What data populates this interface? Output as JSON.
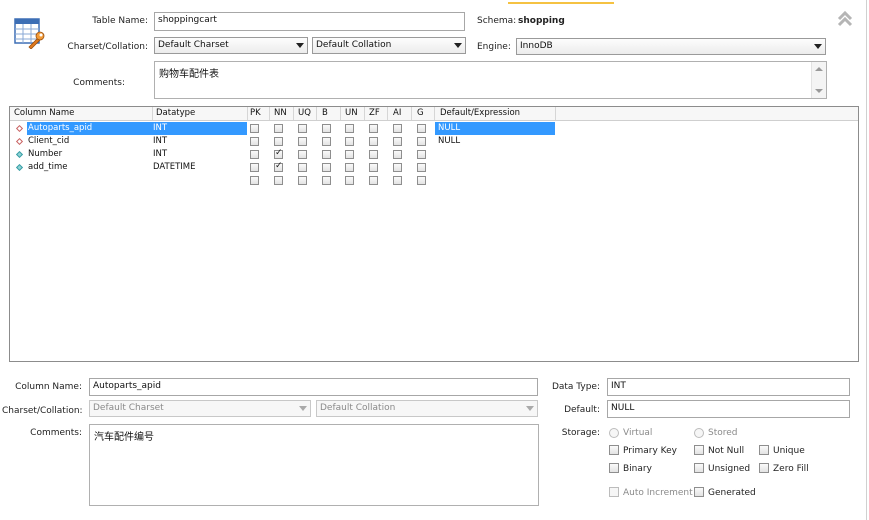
{
  "table": {
    "name_label": "Table Name:",
    "name_value": "shoppingcart",
    "schema_label": "Schema:",
    "schema_value": "shopping",
    "charset_label": "Charset/Collation:",
    "charset_value": "Default Charset",
    "collation_value": "Default Collation",
    "engine_label": "Engine:",
    "engine_value": "InnoDB",
    "comments_label": "Comments:",
    "comments_value": "购物车配件表"
  },
  "grid": {
    "headers": [
      "Column Name",
      "Datatype",
      "PK",
      "NN",
      "UQ",
      "B",
      "UN",
      "ZF",
      "AI",
      "G",
      "Default/Expression"
    ],
    "rows": [
      {
        "name": "Autoparts_apid",
        "type": "INT",
        "flags": [
          false,
          false,
          false,
          false,
          false,
          false,
          false,
          false
        ],
        "default": "NULL",
        "selected": true,
        "icon": "red"
      },
      {
        "name": "Client_cid",
        "type": "INT",
        "flags": [
          false,
          false,
          false,
          false,
          false,
          false,
          false,
          false
        ],
        "default": "NULL",
        "selected": false,
        "icon": "red"
      },
      {
        "name": "Number",
        "type": "INT",
        "flags": [
          false,
          true,
          false,
          false,
          false,
          false,
          false,
          false
        ],
        "default": "",
        "selected": false,
        "icon": "teal"
      },
      {
        "name": "add_time",
        "type": "DATETIME",
        "flags": [
          false,
          true,
          false,
          false,
          false,
          false,
          false,
          false
        ],
        "default": "",
        "selected": false,
        "icon": "teal"
      }
    ]
  },
  "column": {
    "name_label": "Column Name:",
    "name_value": "Autoparts_apid",
    "charset_label": "Charset/Collation:",
    "charset_value": "Default Charset",
    "collation_value": "Default Collation",
    "comments_label": "Comments:",
    "comments_value": "汽车配件编号",
    "datatype_label": "Data Type:",
    "datatype_value": "INT",
    "default_label": "Default:",
    "default_value": "NULL",
    "storage_label": "Storage:",
    "virtual_label": "Virtual",
    "stored_label": "Stored",
    "primary_key_label": "Primary Key",
    "not_null_label": "Not Null",
    "unique_label": "Unique",
    "binary_label": "Binary",
    "unsigned_label": "Unsigned",
    "zero_fill_label": "Zero Fill",
    "auto_increment_label": "Auto Increment",
    "generated_label": "Generated"
  },
  "colors": {
    "selection": "#3399ff",
    "accent_line": "#f5c242"
  },
  "icons": {
    "table_icon": "table-wrench-icon",
    "collapse_icon": "double-chevron-up-icon"
  }
}
